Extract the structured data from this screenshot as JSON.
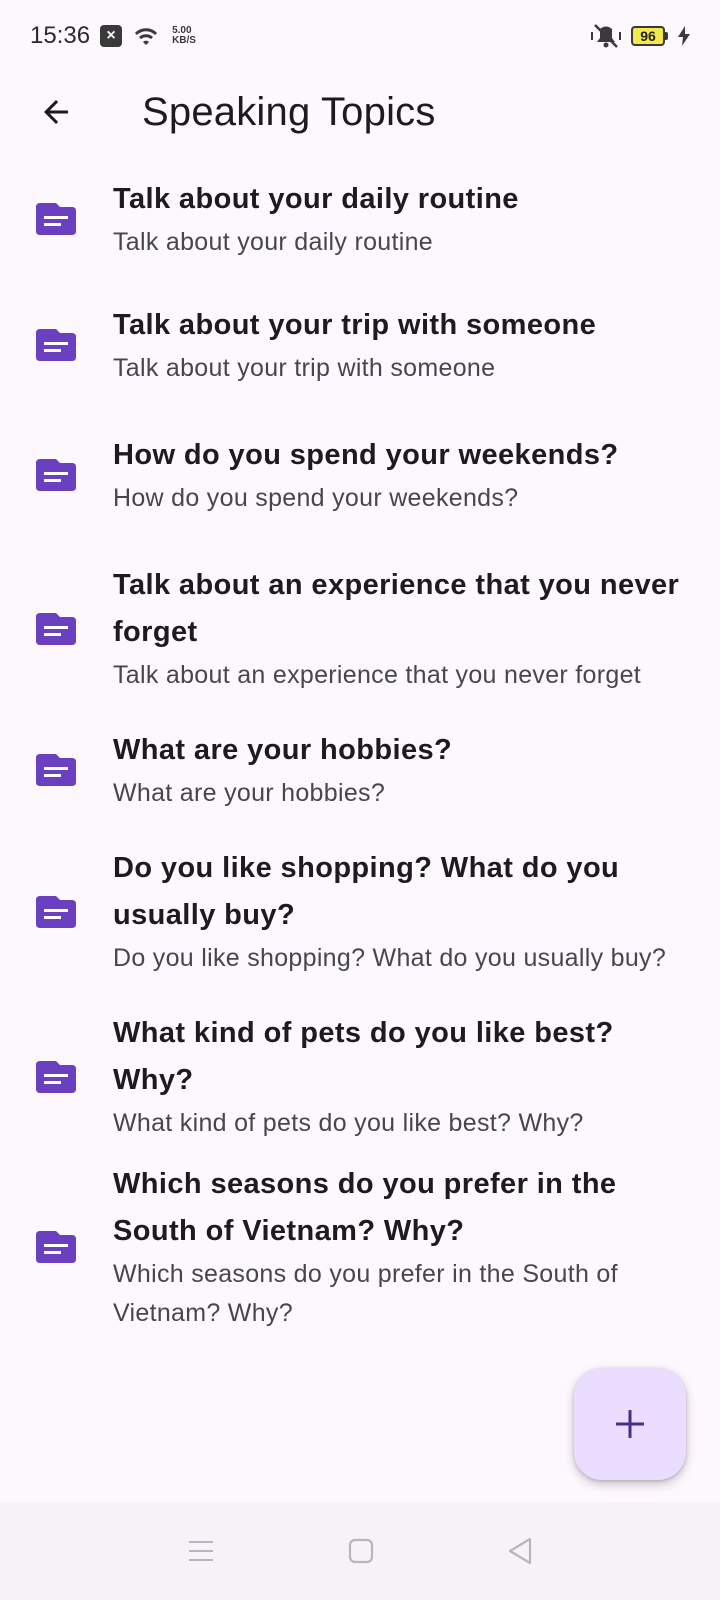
{
  "status_bar": {
    "time": "15:36",
    "speed_value": "5.00",
    "speed_unit": "KB/S",
    "battery": "96"
  },
  "app_bar": {
    "title": "Speaking Topics"
  },
  "topics": [
    {
      "title": "Talk about your daily routine",
      "subtitle": "Talk about your daily routine"
    },
    {
      "title": "Talk about your trip with someone",
      "subtitle": "Talk about your trip with someone"
    },
    {
      "title": "How do you spend your weekends?",
      "subtitle": "How do you spend your weekends?"
    },
    {
      "title": "Talk about an experience that you never forget",
      "subtitle": "Talk about an experience that you never forget"
    },
    {
      "title": "What are your hobbies?",
      "subtitle": "What are your hobbies?"
    },
    {
      "title": "Do you like shopping? What do you usually buy?",
      "subtitle": "Do you like shopping? What do you usually buy?"
    },
    {
      "title": "What kind of pets do you like best? Why?",
      "subtitle": "What kind of pets do you like best? Why?"
    },
    {
      "title": "Which seasons do you prefer in the South of Vietnam? Why?",
      "subtitle": "Which seasons do you prefer in the South of Vietnam? Why?"
    }
  ],
  "icons": {
    "topic": "document-folder-icon",
    "back": "arrow-back-icon",
    "fab": "add-icon"
  },
  "colors": {
    "accent": "#6a3fc0",
    "background": "#fdf7fe",
    "fab_background": "#eaddff"
  }
}
